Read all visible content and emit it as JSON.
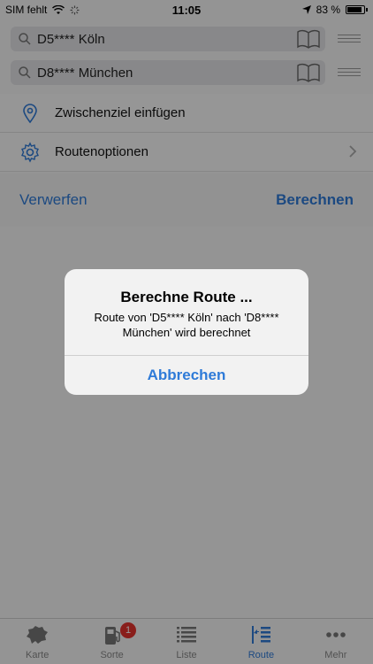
{
  "status_bar": {
    "carrier": "SIM fehlt",
    "time": "11:05",
    "battery": "83 %"
  },
  "route": {
    "from": "D5**** Köln",
    "to": "D8**** München"
  },
  "menu": {
    "waypoint_label": "Zwischenziel einfügen",
    "options_label": "Routenoptionen"
  },
  "actions": {
    "discard_label": "Verwerfen",
    "calculate_label": "Berechnen"
  },
  "tabbar": {
    "tabs": [
      {
        "label": "Karte",
        "icon": "europe-map-icon"
      },
      {
        "label": "Sorte",
        "icon": "fuel-pump-icon",
        "badge": "1"
      },
      {
        "label": "Liste",
        "icon": "list-icon"
      },
      {
        "label": "Route",
        "icon": "route-icon",
        "active": true
      },
      {
        "label": "Mehr",
        "icon": "more-icon"
      }
    ]
  },
  "alert": {
    "title": "Berechne Route ...",
    "message": "Route von 'D5**** Köln' nach 'D8**** München' wird berechnet",
    "cancel_label": "Abbrechen"
  },
  "colors": {
    "accent": "#2f7bd8",
    "badge": "#e5322d"
  }
}
